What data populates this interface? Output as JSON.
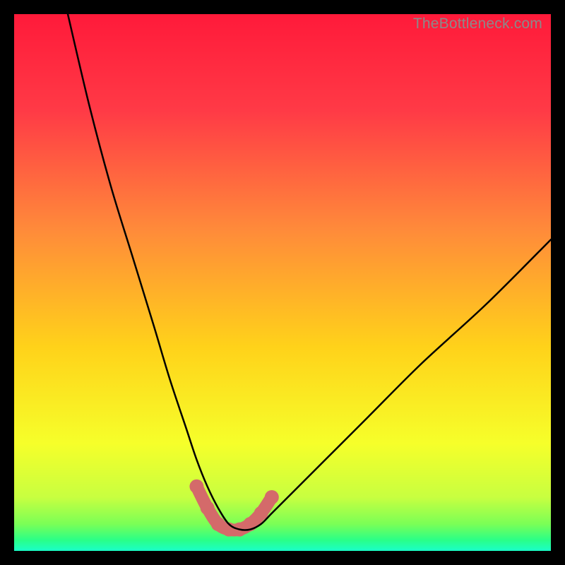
{
  "watermark": "TheBottleneck.com",
  "chart_data": {
    "type": "line",
    "title": "",
    "xlabel": "",
    "ylabel": "",
    "xlim": [
      0,
      100
    ],
    "ylim": [
      0,
      100
    ],
    "description": "Bottleneck curve: V-shaped black curve over a vertical heat gradient (red top → yellow → green bottom). The minimum (optimal region) sits near x≈38–45, highlighted with a thick salmon segment near the bottom.",
    "series": [
      {
        "name": "bottleneck-curve",
        "x": [
          10,
          14,
          18,
          22,
          26,
          29,
          32,
          34,
          36,
          38,
          40,
          42,
          44,
          46,
          48,
          52,
          58,
          66,
          76,
          88,
          100
        ],
        "y": [
          100,
          83,
          68,
          55,
          42,
          32,
          23,
          17,
          12,
          8,
          5,
          4,
          4,
          5,
          7,
          11,
          17,
          25,
          35,
          46,
          58
        ]
      },
      {
        "name": "optimal-region",
        "x": [
          34,
          36,
          38,
          40,
          42,
          44,
          46,
          48
        ],
        "y": [
          12,
          8,
          5,
          4,
          4,
          5,
          7,
          10
        ]
      }
    ],
    "gradient_stops": [
      {
        "pos": 0.0,
        "color": "#ff1a3a"
      },
      {
        "pos": 0.18,
        "color": "#ff3a46"
      },
      {
        "pos": 0.4,
        "color": "#ff8a3a"
      },
      {
        "pos": 0.62,
        "color": "#ffd21a"
      },
      {
        "pos": 0.8,
        "color": "#f6ff2a"
      },
      {
        "pos": 0.9,
        "color": "#c8ff40"
      },
      {
        "pos": 0.95,
        "color": "#7aff56"
      },
      {
        "pos": 0.98,
        "color": "#2aff88"
      },
      {
        "pos": 1.0,
        "color": "#1affc8"
      }
    ]
  }
}
